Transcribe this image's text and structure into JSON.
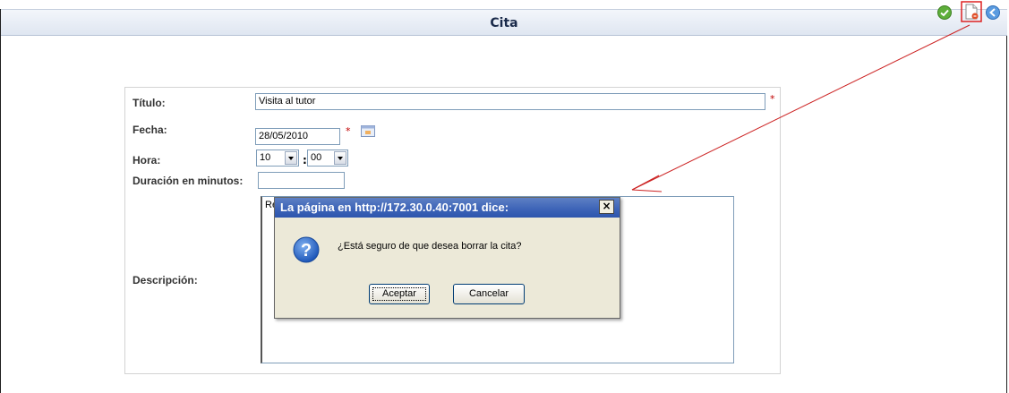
{
  "header": {
    "title": "Cita",
    "icons": [
      "ok-icon",
      "delete-icon",
      "back-icon"
    ]
  },
  "form": {
    "titulo_label": "Título:",
    "titulo_value": "Visita al tutor",
    "fecha_label": "Fecha:",
    "fecha_value": "28/05/2010",
    "hora_label": "Hora:",
    "hora_hours": "10",
    "hora_minutes": "00",
    "duracion_label": "Duración en minutos:",
    "duracion_value": "",
    "descripcion_label": "Descripción:",
    "descripcion_value": "Re",
    "required_mark": "*"
  },
  "dialog": {
    "title": "La página en http://172.30.0.40:7001 dice:",
    "close_label": "×",
    "message": "¿Está seguro de que desea borrar la cita?",
    "ok_label": "Aceptar",
    "cancel_label": "Cancelar"
  },
  "colors": {
    "header_text": "#1a2a4a",
    "required": "#c00000",
    "dialog_title_bg": "#3c63b7",
    "dialog_bg": "#ece9d8",
    "annotation": "#cc2222"
  }
}
